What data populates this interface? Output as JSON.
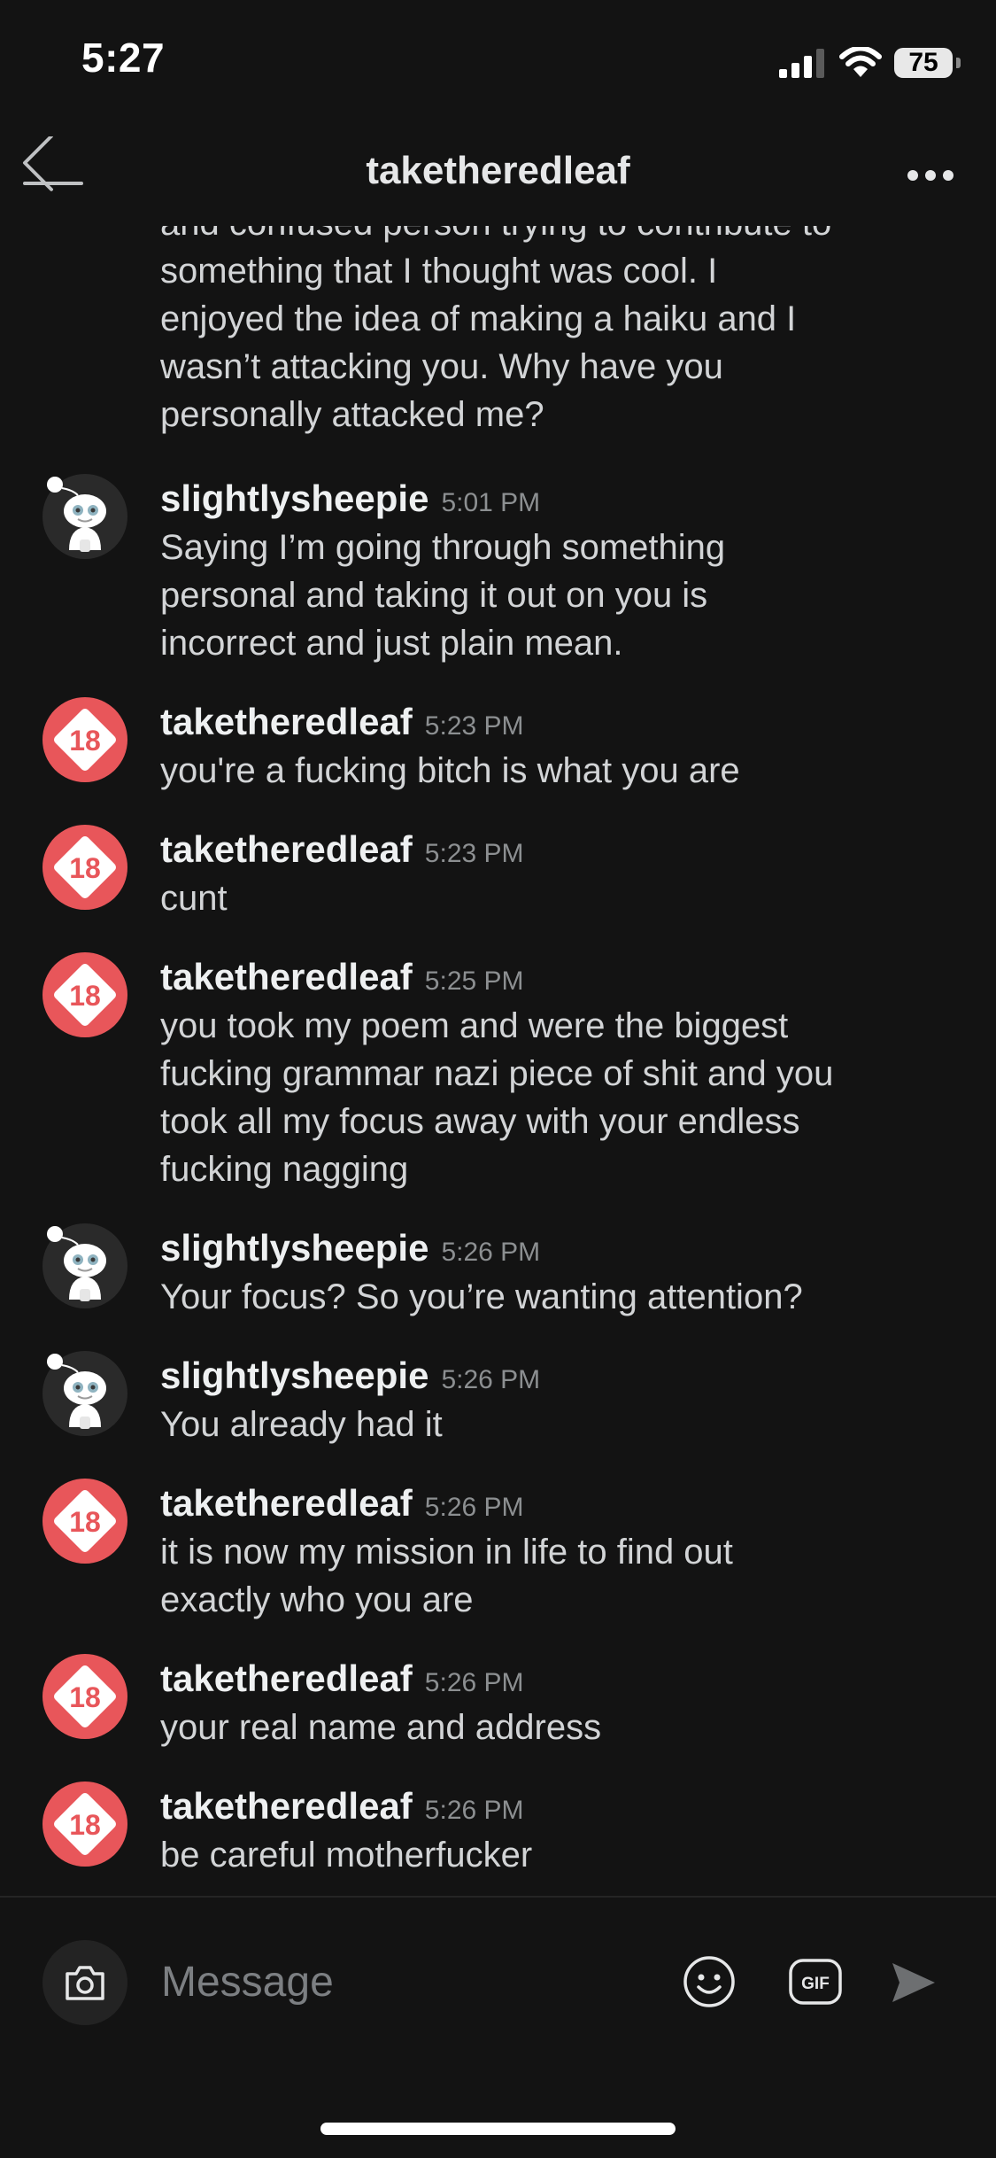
{
  "status_bar": {
    "time": "5:27",
    "battery": "75"
  },
  "header": {
    "title": "taketheredleaf"
  },
  "partial_message": {
    "lines": [
      "and confused person trying to contribute to",
      "something that I thought was cool. I",
      "enjoyed the idea of making a haiku and I",
      "wasn’t attacking you. Why have you",
      "personally attacked me?"
    ]
  },
  "messages": [
    {
      "author": "slightlysheepie",
      "time": "5:01 PM",
      "avatar": "snoo-avatar-icon",
      "lines": [
        "Saying I’m going through something",
        "personal and taking it out on you is",
        "incorrect and just plain mean."
      ]
    },
    {
      "author": "taketheredleaf",
      "time": "5:23 PM",
      "avatar": "nsfw-18-avatar-icon",
      "lines": [
        "you're a fucking bitch is what you are"
      ]
    },
    {
      "author": "taketheredleaf",
      "time": "5:23 PM",
      "avatar": "nsfw-18-avatar-icon",
      "lines": [
        "cunt"
      ]
    },
    {
      "author": "taketheredleaf",
      "time": "5:25 PM",
      "avatar": "nsfw-18-avatar-icon",
      "lines": [
        "you took my poem and were the biggest",
        "fucking grammar nazi piece of shit and you",
        "took all my focus away with your endless",
        "fucking nagging"
      ]
    },
    {
      "author": "slightlysheepie",
      "time": "5:26 PM",
      "avatar": "snoo-avatar-icon",
      "lines": [
        "Your focus? So you’re wanting attention?"
      ]
    },
    {
      "author": "slightlysheepie",
      "time": "5:26 PM",
      "avatar": "snoo-avatar-icon",
      "lines": [
        "You already had it"
      ]
    },
    {
      "author": "taketheredleaf",
      "time": "5:26 PM",
      "avatar": "nsfw-18-avatar-icon",
      "lines": [
        "it is now my mission in life to find out",
        "exactly who you are"
      ]
    },
    {
      "author": "taketheredleaf",
      "time": "5:26 PM",
      "avatar": "nsfw-18-avatar-icon",
      "lines": [
        "your real name and address"
      ]
    },
    {
      "author": "taketheredleaf",
      "time": "5:26 PM",
      "avatar": "nsfw-18-avatar-icon",
      "lines": [
        "be careful motherfucker"
      ]
    }
  ],
  "composer": {
    "placeholder": "Message",
    "gif_label": "GIF"
  },
  "icons": {
    "back": "back-arrow-icon",
    "more": "more-dots-icon",
    "camera": "camera-icon",
    "emoji": "emoji-icon",
    "gif": "gif-icon",
    "send": "send-icon"
  },
  "colors": {
    "background": "#131313",
    "nsfw_badge": "#e8565a",
    "text_primary": "#eef0f1",
    "text_secondary": "#8c8f91"
  }
}
